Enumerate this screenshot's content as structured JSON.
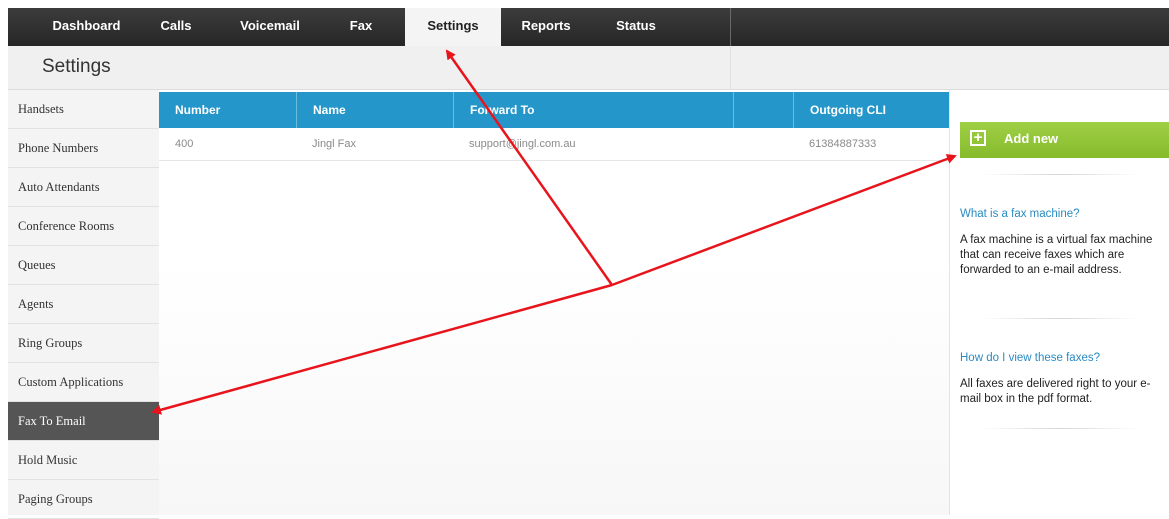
{
  "nav": {
    "tabs": [
      {
        "label": "Dashboard"
      },
      {
        "label": "Calls"
      },
      {
        "label": "Voicemail"
      },
      {
        "label": "Fax"
      },
      {
        "label": "Settings",
        "active": true
      },
      {
        "label": "Reports"
      },
      {
        "label": "Status"
      }
    ]
  },
  "page": {
    "title": "Settings"
  },
  "sidebar": {
    "items": [
      {
        "label": "Handsets"
      },
      {
        "label": "Phone Numbers"
      },
      {
        "label": "Auto Attendants"
      },
      {
        "label": "Conference Rooms"
      },
      {
        "label": "Queues"
      },
      {
        "label": "Agents"
      },
      {
        "label": "Ring Groups"
      },
      {
        "label": "Custom Applications"
      },
      {
        "label": "Fax To Email",
        "active": true
      },
      {
        "label": "Hold Music"
      },
      {
        "label": "Paging Groups"
      }
    ]
  },
  "table": {
    "columns": [
      "Number",
      "Name",
      "Forward To",
      "Outgoing CLI"
    ],
    "rows": [
      {
        "number": "400",
        "name": "Jingl Fax",
        "forward_to": "support@jingl.com.au",
        "outgoing_cli": "61384887333"
      }
    ]
  },
  "right_panel": {
    "add_new_label": "Add new",
    "faq": [
      {
        "question": "What is a fax machine?",
        "answer": "A fax machine is a virtual fax machine that can receive faxes which are forwarded to an e-mail address."
      },
      {
        "question": "How do I view these faxes?",
        "answer": "All faxes are delivered right to your e-mail box in the pdf format."
      }
    ]
  },
  "colors": {
    "topbar": "#2b2b2b",
    "table_header": "#2596c9",
    "add_button": "#8cc63f",
    "active_sidebar": "#555555",
    "link": "#2a8bc2",
    "annotation_arrow": "#e8141c"
  },
  "icons": {
    "add": "plus-square-icon"
  }
}
